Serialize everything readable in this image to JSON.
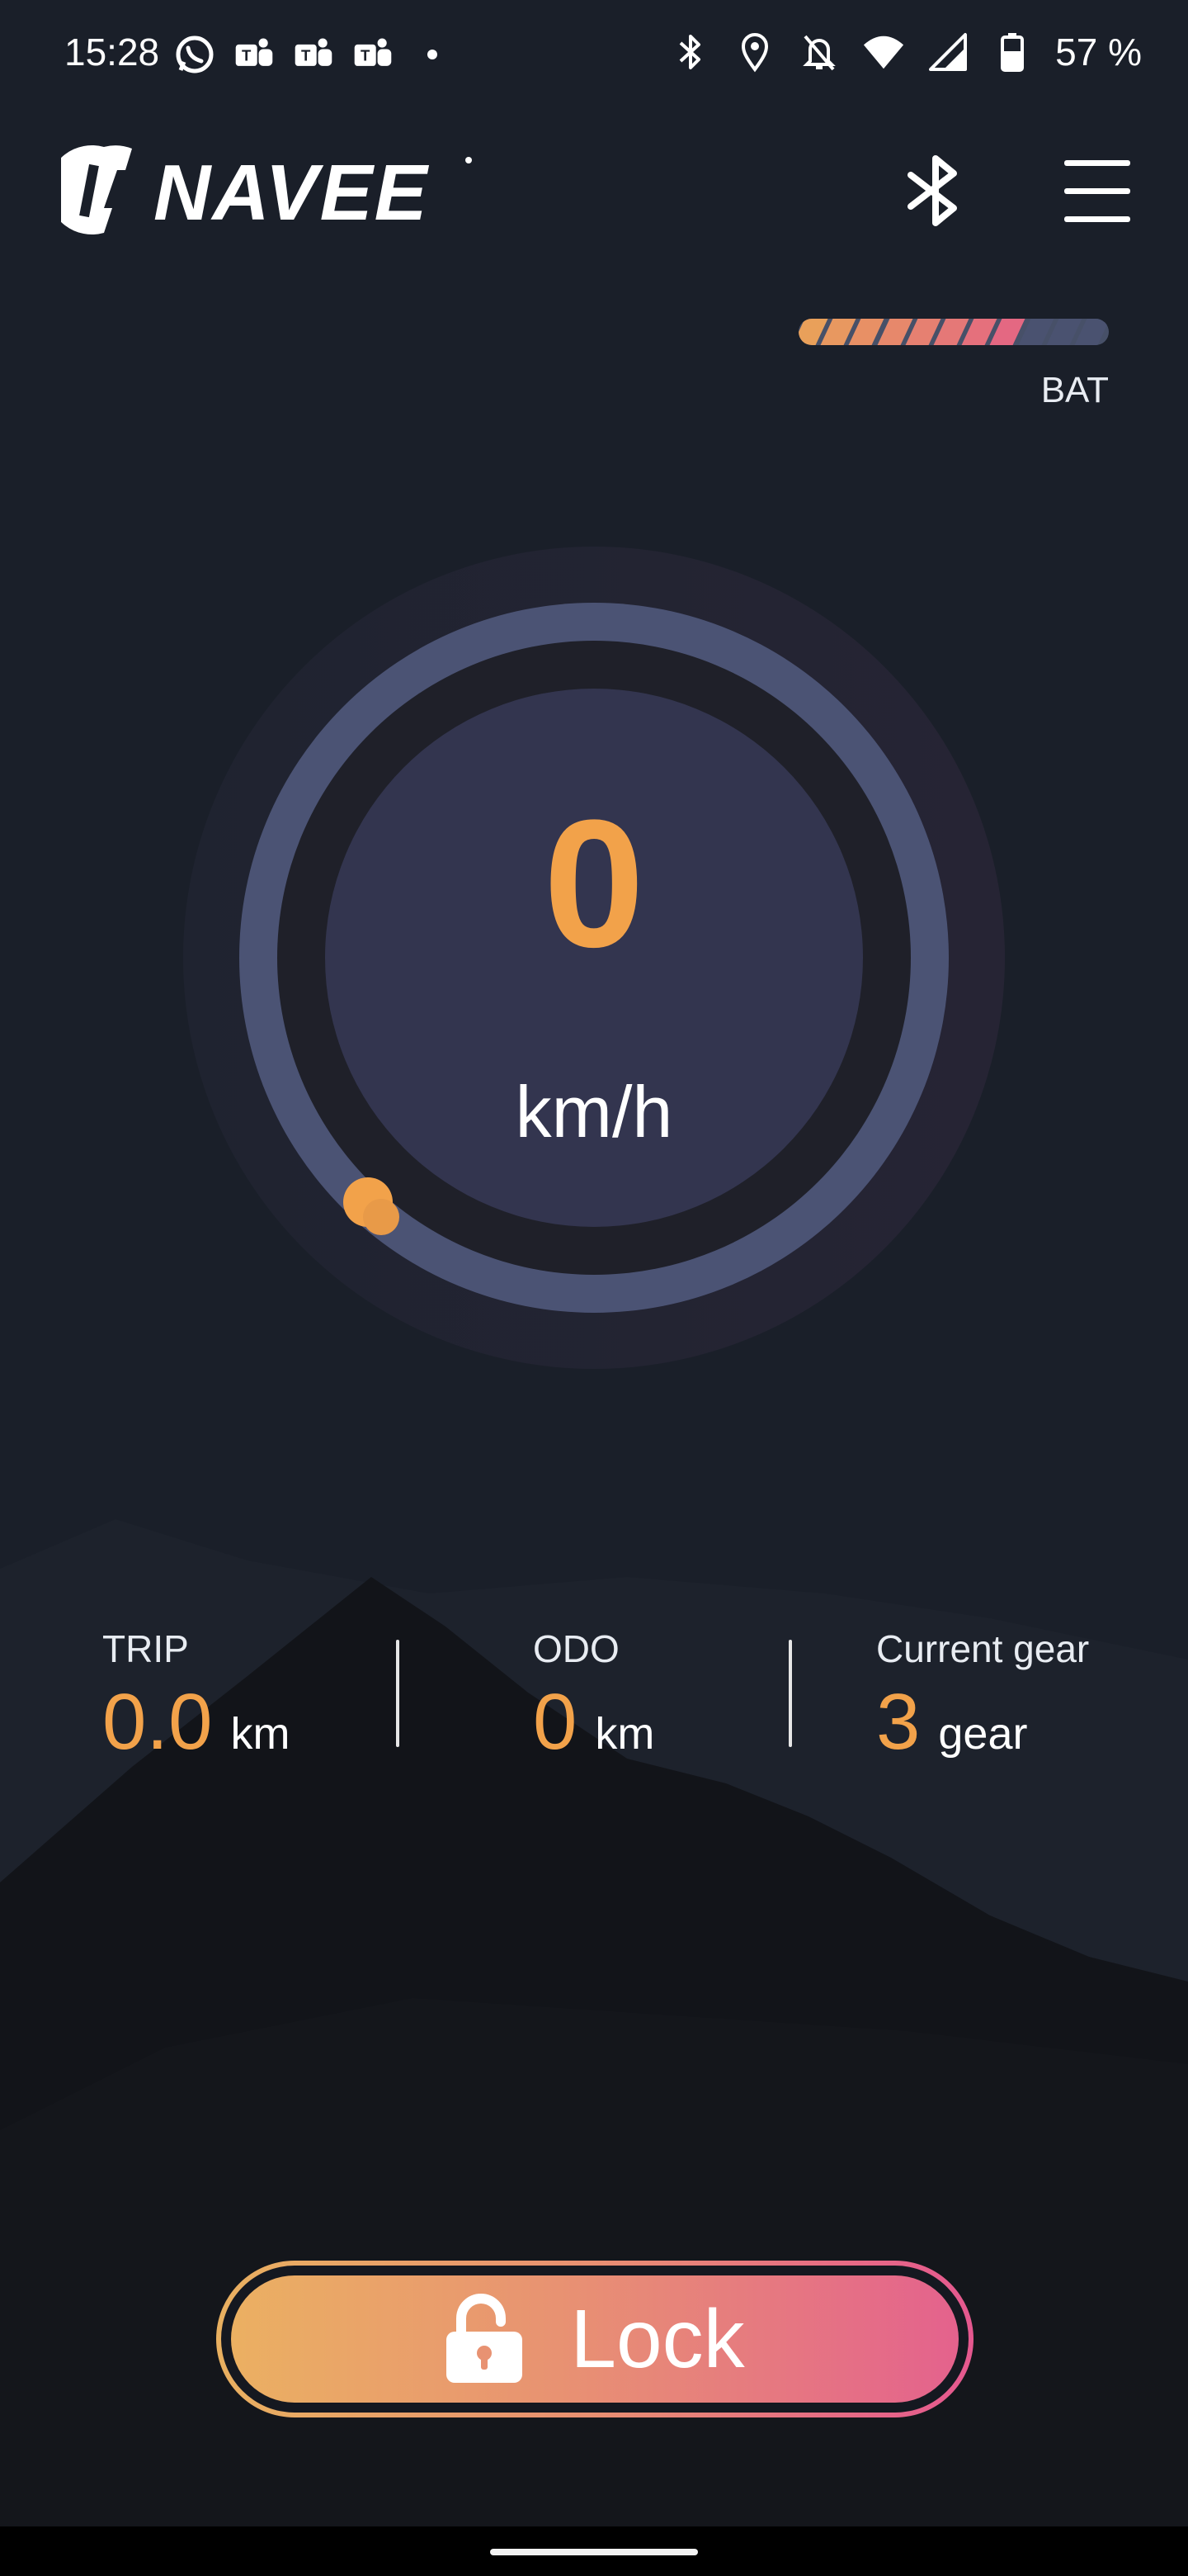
{
  "status_bar": {
    "time": "15:28",
    "battery_text": "57 %",
    "left_icons": [
      "whatsapp-icon",
      "teams-icon",
      "teams-icon",
      "teams-icon",
      "dot-icon"
    ],
    "right_icons": [
      "bluetooth-icon",
      "location-icon",
      "bell-off-icon",
      "wifi-icon",
      "signal-icon",
      "battery-icon"
    ]
  },
  "header": {
    "brand": "NAVEE",
    "bluetooth_icon": "bluetooth-icon",
    "menu_icon": "menu-icon"
  },
  "battery": {
    "label": "BAT",
    "segments_total": 11,
    "segments_filled": 8
  },
  "speedometer": {
    "value": "0",
    "unit": "km/h",
    "progress": 0
  },
  "stats": [
    {
      "label": "TRIP",
      "value": "0.0",
      "unit": "km"
    },
    {
      "label": "ODO",
      "value": "0",
      "unit": "km"
    },
    {
      "label": "Current gear",
      "value": "3",
      "unit": "gear"
    }
  ],
  "lock_button": {
    "label": "Lock",
    "icon": "unlock-icon"
  },
  "colors": {
    "background": "#1a1f29",
    "accent_orange": "#f2a24a",
    "accent_pink": "#e4628d",
    "gauge_ring": "#4a5170",
    "gauge_inner": "#33354f"
  }
}
